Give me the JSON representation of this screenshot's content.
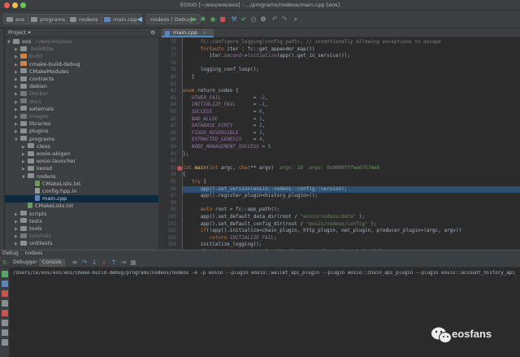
{
  "window": {
    "title": "EOSIO [~/eos/eos/eos] - .../programs/nodeos/main.cpp [eos]"
  },
  "navbar": {
    "breadcrumbs": [
      "eos",
      "programs",
      "nodeos",
      "main.cpp"
    ],
    "run_config": "nodeos | Debug"
  },
  "project_panel": {
    "title": "Project",
    "items": [
      {
        "label": "eos",
        "extra": "~/eos/eos/eos",
        "arrow": "▼",
        "kind": "norm",
        "indent": 0
      },
      {
        "label": ".buildkite",
        "arrow": "▶",
        "kind": "norm",
        "indent": 1,
        "dim": true
      },
      {
        "label": "build",
        "arrow": "▶",
        "kind": "orange",
        "indent": 1,
        "dim": true
      },
      {
        "label": "cmake-build-debug",
        "arrow": "▶",
        "kind": "orange",
        "indent": 1
      },
      {
        "label": "CMakeModules",
        "arrow": "▶",
        "kind": "norm",
        "indent": 1
      },
      {
        "label": "contracts",
        "arrow": "▶",
        "kind": "norm",
        "indent": 1
      },
      {
        "label": "debian",
        "arrow": "▶",
        "kind": "norm",
        "indent": 1
      },
      {
        "label": "Docker",
        "arrow": "▶",
        "kind": "gray",
        "indent": 1,
        "dim": true
      },
      {
        "label": "docs",
        "arrow": "▶",
        "kind": "gray",
        "indent": 1,
        "dim": true
      },
      {
        "label": "externals",
        "arrow": "▶",
        "kind": "norm",
        "indent": 1
      },
      {
        "label": "images",
        "arrow": "▶",
        "kind": "gray",
        "indent": 1,
        "dim": true
      },
      {
        "label": "libraries",
        "arrow": "▶",
        "kind": "norm",
        "indent": 1
      },
      {
        "label": "plugins",
        "arrow": "▶",
        "kind": "norm",
        "indent": 1
      },
      {
        "label": "programs",
        "arrow": "▼",
        "kind": "norm",
        "indent": 1
      },
      {
        "label": "cleos",
        "arrow": "▶",
        "kind": "norm",
        "indent": 2
      },
      {
        "label": "eosio-abigen",
        "arrow": "▶",
        "kind": "norm",
        "indent": 2
      },
      {
        "label": "eosio-launcher",
        "arrow": "▶",
        "kind": "norm",
        "indent": 2
      },
      {
        "label": "keosd",
        "arrow": "▶",
        "kind": "norm",
        "indent": 2
      },
      {
        "label": "nodeos",
        "arrow": "▼",
        "kind": "norm",
        "indent": 2
      },
      {
        "label": "CMakeLists.txt",
        "arrow": "",
        "kind": "cmake",
        "indent": 3
      },
      {
        "label": "config.hpp.in",
        "arrow": "",
        "kind": "file",
        "indent": 3
      },
      {
        "label": "main.cpp",
        "arrow": "",
        "kind": "cpp",
        "indent": 3,
        "selected": true
      },
      {
        "label": "CMakeLists.txt",
        "arrow": "",
        "kind": "cmake",
        "indent": 2
      },
      {
        "label": "scripts",
        "arrow": "▶",
        "kind": "norm",
        "indent": 1
      },
      {
        "label": "tests",
        "arrow": "▶",
        "kind": "norm",
        "indent": 1
      },
      {
        "label": "tools",
        "arrow": "▶",
        "kind": "norm",
        "indent": 1
      },
      {
        "label": "tutorials",
        "arrow": "▶",
        "kind": "gray",
        "indent": 1,
        "dim": true
      },
      {
        "label": "unittests",
        "arrow": "▶",
        "kind": "norm",
        "indent": 1
      }
    ]
  },
  "editor": {
    "tab_label": "main.cpp",
    "line_numbers": [
      "75",
      "76",
      "77",
      "78",
      "79",
      "80",
      "81",
      "82",
      "83",
      "84",
      "85",
      "86",
      "87",
      "88",
      "89",
      "90",
      "91",
      "92",
      "93",
      "94",
      "95",
      "96",
      "97",
      "98",
      "99",
      "100",
      "101",
      "102",
      "103",
      "104",
      "105",
      "106",
      "107",
      "108",
      "109",
      "110",
      "111"
    ],
    "breakpoint_line": "98",
    "highlight_line_index": 18,
    "lines": [
      [
        [
          "      fc::configure_logging(config_path); // intentionally allowing exceptions to escape",
          "c"
        ]
      ],
      [
        [
          "      for",
          "k"
        ],
        [
          "(",
          "t"
        ],
        [
          "auto",
          "k"
        ],
        [
          " iter : fc::get_appender_map())",
          "t"
        ]
      ],
      [
        [
          "         iter.",
          "t"
        ],
        [
          "second",
          "m"
        ],
        [
          "->",
          "t"
        ],
        [
          "initialize",
          "m"
        ],
        [
          "(app().get_io_service());",
          "t"
        ]
      ],
      [
        [
          "",
          "t"
        ]
      ],
      [
        [
          "      logging_conf_loop();",
          "t"
        ]
      ],
      [
        [
          "   }",
          "t"
        ]
      ],
      [
        [
          "",
          "t"
        ]
      ],
      [
        [
          "enum",
          "k"
        ],
        [
          " return_codes {",
          "t"
        ]
      ],
      [
        [
          "   OTHER_FAIL",
          "m"
        ],
        [
          "           = -",
          "t"
        ],
        [
          "2",
          "n"
        ],
        [
          ",",
          "t"
        ]
      ],
      [
        [
          "   INITIALIZE_FAIL",
          "m"
        ],
        [
          "      = -",
          "t"
        ],
        [
          "1",
          "n"
        ],
        [
          ",",
          "t"
        ]
      ],
      [
        [
          "   SUCCESS",
          "m"
        ],
        [
          "              = ",
          "t"
        ],
        [
          "0",
          "n"
        ],
        [
          ",",
          "t"
        ]
      ],
      [
        [
          "   BAD_ALLOC",
          "m"
        ],
        [
          "            = ",
          "t"
        ],
        [
          "1",
          "n"
        ],
        [
          ",",
          "t"
        ]
      ],
      [
        [
          "   DATABASE_DIRTY",
          "m"
        ],
        [
          "       = ",
          "t"
        ],
        [
          "2",
          "n"
        ],
        [
          ",",
          "t"
        ]
      ],
      [
        [
          "   FIXED_REVERSIBLE",
          "m"
        ],
        [
          "     = ",
          "t"
        ],
        [
          "3",
          "n"
        ],
        [
          ",",
          "t"
        ]
      ],
      [
        [
          "   EXTRACTED_GENESIS",
          "m"
        ],
        [
          "    = ",
          "t"
        ],
        [
          "4",
          "n"
        ],
        [
          ",",
          "t"
        ]
      ],
      [
        [
          "   NODE_MANAGEMENT_SUCCESS",
          "m"
        ],
        [
          " = ",
          "t"
        ],
        [
          "5",
          "n"
        ],
        [
          "",
          "t"
        ]
      ],
      [
        [
          "};",
          "t"
        ]
      ],
      [
        [
          "",
          "t"
        ]
      ],
      [
        [
          "int",
          "k"
        ],
        [
          " ",
          "t"
        ],
        [
          "main",
          "f"
        ],
        [
          "(",
          "t"
        ],
        [
          "int",
          "k"
        ],
        [
          " argc, ",
          "t"
        ],
        [
          "char",
          "k"
        ],
        [
          "** argv)  ",
          "t"
        ],
        [
          "argc: 18  argv: 0x00007ffee67574e0",
          "hint"
        ]
      ],
      [
        [
          "{",
          "t"
        ]
      ],
      [
        [
          "   try",
          "k"
        ],
        [
          " {",
          "t"
        ]
      ],
      [
        [
          "      app().set_version(eosio::nodeos::config::version);",
          "t"
        ]
      ],
      [
        [
          "      app().register_plugin<history_plugin>();",
          "t"
        ]
      ],
      [
        [
          "",
          "t"
        ]
      ],
      [
        [
          "      auto",
          "k"
        ],
        [
          " root = fc::app_path();",
          "t"
        ]
      ],
      [
        [
          "      app().set_default_data_dir(root / ",
          "t"
        ],
        [
          "\"eosio/nodeos/data\"",
          "s"
        ],
        [
          " );",
          "t"
        ]
      ],
      [
        [
          "      app().set_default_config_dir(root / ",
          "t"
        ],
        [
          "\"eosio/nodeos/config\"",
          "s"
        ],
        [
          " );",
          "t"
        ]
      ],
      [
        [
          "      if",
          "k"
        ],
        [
          "(!app().initialize<chain_plugin, http_plugin, net_plugin, producer_plugin>(argc, argv))",
          "t"
        ]
      ],
      [
        [
          "         return",
          "k"
        ],
        [
          " ",
          "t"
        ],
        [
          "INITIALIZE_FAIL",
          "m"
        ],
        [
          ";",
          "t"
        ]
      ],
      [
        [
          "      initialize_logging();",
          "t"
        ]
      ],
      [
        [
          "      ilog(",
          "t"
        ],
        [
          "\"nodeos version ${ver}\"",
          "s"
        ],
        [
          ", (",
          "t"
        ],
        [
          "\"ver\"",
          "s"
        ],
        [
          ", app().version_string()));",
          "t"
        ]
      ],
      [
        [
          "      ilog(",
          "t"
        ],
        [
          "\"eosio root is ${root}\"",
          "s"
        ],
        [
          ", (",
          "t"
        ],
        [
          "\"root\"",
          "s"
        ],
        [
          ", root.string()));",
          "t"
        ]
      ],
      [
        [
          "      app().startup();",
          "t"
        ]
      ],
      [
        [
          "      app().exec();",
          "t"
        ]
      ],
      [
        [
          "   } ",
          "t"
        ],
        [
          "catch",
          "k"
        ],
        [
          "( ",
          "t"
        ],
        [
          "const",
          "k"
        ],
        [
          " extract_genesis_state_exception& e ) {",
          "t"
        ]
      ],
      [
        [
          "      return",
          "k"
        ],
        [
          " ",
          "t"
        ],
        [
          "EXTRACTED_GENESIS",
          "m"
        ],
        [
          ";",
          "t"
        ]
      ],
      [
        [
          "   } ",
          "t"
        ],
        [
          "catch",
          "k"
        ],
        [
          "( ",
          "t"
        ],
        [
          "const",
          "k"
        ],
        [
          " fixed_reversible_db_exception& e ) {",
          "t"
        ]
      ]
    ]
  },
  "debug": {
    "header": "Debug",
    "config": "nodeos",
    "tabs": [
      "Debugger",
      "Console"
    ],
    "command": "/Users/ce/eos/eos/eos/cmake-build-debug/programs/nodeos/nodeos -e -p eosio --plugin eosio::wallet_api_plugin --plugin eosio::chain_api_plugin --plugin eosio::account_history_api_plugin"
  },
  "watermark": {
    "text": "eosfans"
  },
  "colors": {
    "background": "#2b2b2b",
    "panel": "#3c3f41",
    "selection": "#2d4f71",
    "breakpoint": "#c75450",
    "run_green": "#59a869"
  }
}
